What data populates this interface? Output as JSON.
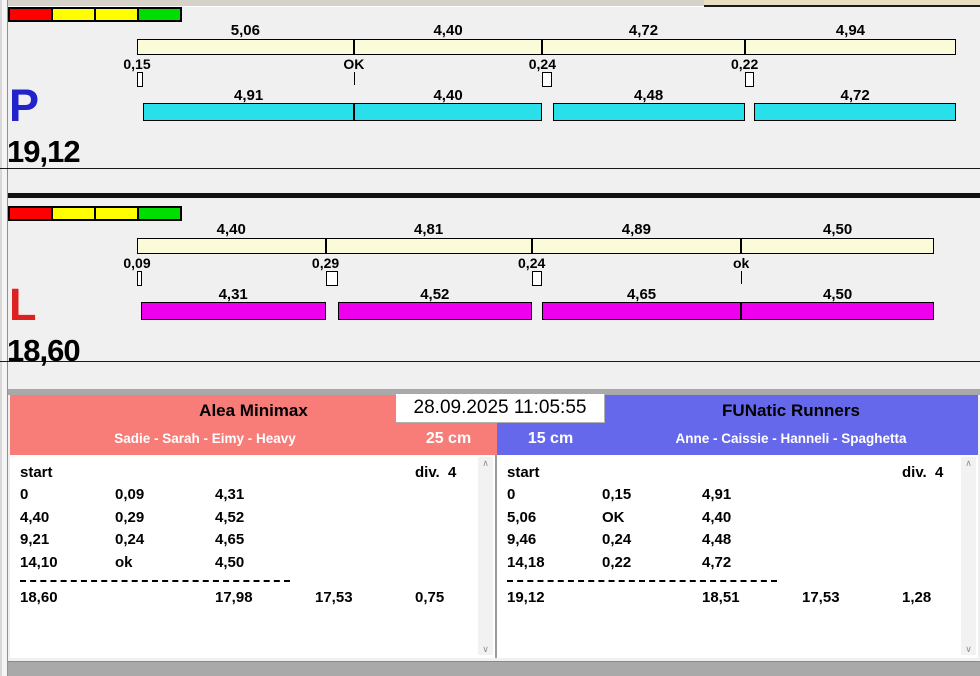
{
  "datetime": "28.09.2025 11:05:55",
  "colors": {
    "top_bar": "#fbfbda",
    "lane_p_bar": "#29e0ea",
    "lane_l_bar": "#ee00ee",
    "team_left_header": "#f87c78",
    "team_right_header": "#6668ec",
    "swatch_red": "#ff0000",
    "swatch_yellow": "#ffff00",
    "swatch_green": "#00dd00"
  },
  "traffic_swatches": [
    "#ff0000",
    "#ffff00",
    "#ffff00",
    "#00dd00"
  ],
  "lanes": [
    {
      "letter": "P",
      "letter_color": "#2323cb",
      "total": "19,12",
      "bar_color": "#29e0ea",
      "top_segments": [
        {
          "label": "5,06",
          "value": 5.06
        },
        {
          "label": "4,40",
          "value": 4.4
        },
        {
          "label": "4,72",
          "value": 4.72
        },
        {
          "label": "4,94",
          "value": 4.94
        }
      ],
      "markers": [
        {
          "label": "0,15",
          "gap": 0.15
        },
        {
          "label": "OK",
          "gap": 0
        },
        {
          "label": "0,24",
          "gap": 0.24
        },
        {
          "label": "0,22",
          "gap": 0.22
        }
      ],
      "bottom_segments": [
        {
          "label": "4,91",
          "value": 4.91
        },
        {
          "label": "4,40",
          "value": 4.4
        },
        {
          "label": "4,48",
          "value": 4.48
        },
        {
          "label": "4,72",
          "value": 4.72
        }
      ]
    },
    {
      "letter": "L",
      "letter_color": "#dd2020",
      "total": "18,60",
      "bar_color": "#ee00ee",
      "top_segments": [
        {
          "label": "4,40",
          "value": 4.4
        },
        {
          "label": "4,81",
          "value": 4.81
        },
        {
          "label": "4,89",
          "value": 4.89
        },
        {
          "label": "4,50",
          "value": 4.5
        }
      ],
      "markers": [
        {
          "label": "0,09",
          "gap": 0.09
        },
        {
          "label": "0,29",
          "gap": 0.29
        },
        {
          "label": "0,24",
          "gap": 0.24
        },
        {
          "label": "ok",
          "gap": 0
        }
      ],
      "bottom_segments": [
        {
          "label": "4,31",
          "value": 4.31
        },
        {
          "label": "4,52",
          "value": 4.52
        },
        {
          "label": "4,65",
          "value": 4.65
        },
        {
          "label": "4,50",
          "value": 4.5
        }
      ]
    }
  ],
  "teams": [
    {
      "name": "Alea Minimax",
      "members": "Sadie - Sarah - Eimy - Heavy",
      "handicap": "25 cm",
      "header_color": "#f87c78",
      "table": {
        "start_label": "start",
        "div_label": "div.  4",
        "rows": [
          [
            "0",
            "0,09",
            "4,31"
          ],
          [
            "4,40",
            "0,29",
            "4,52"
          ],
          [
            "9,21",
            "0,24",
            "4,65"
          ],
          [
            "14,10",
            "ok",
            "4,50"
          ]
        ],
        "totals": [
          "18,60",
          "",
          "17,98",
          "17,53",
          "0,75"
        ]
      }
    },
    {
      "name": "FUNatic Runners",
      "members": "Anne - Caissie - Hanneli - Spaghetta",
      "handicap": "15 cm",
      "header_color": "#6668ec",
      "table": {
        "start_label": "start",
        "div_label": "div.  4",
        "rows": [
          [
            "0",
            "0,15",
            "4,91"
          ],
          [
            "5,06",
            "OK",
            "4,40"
          ],
          [
            "9,46",
            "0,24",
            "4,48"
          ],
          [
            "14,18",
            "0,22",
            "4,72"
          ]
        ],
        "totals": [
          "19,12",
          "",
          "18,51",
          "17,53",
          "1,28"
        ]
      }
    }
  ],
  "scrollbar": {
    "up_glyph": "∧",
    "down_glyph": "∨"
  }
}
